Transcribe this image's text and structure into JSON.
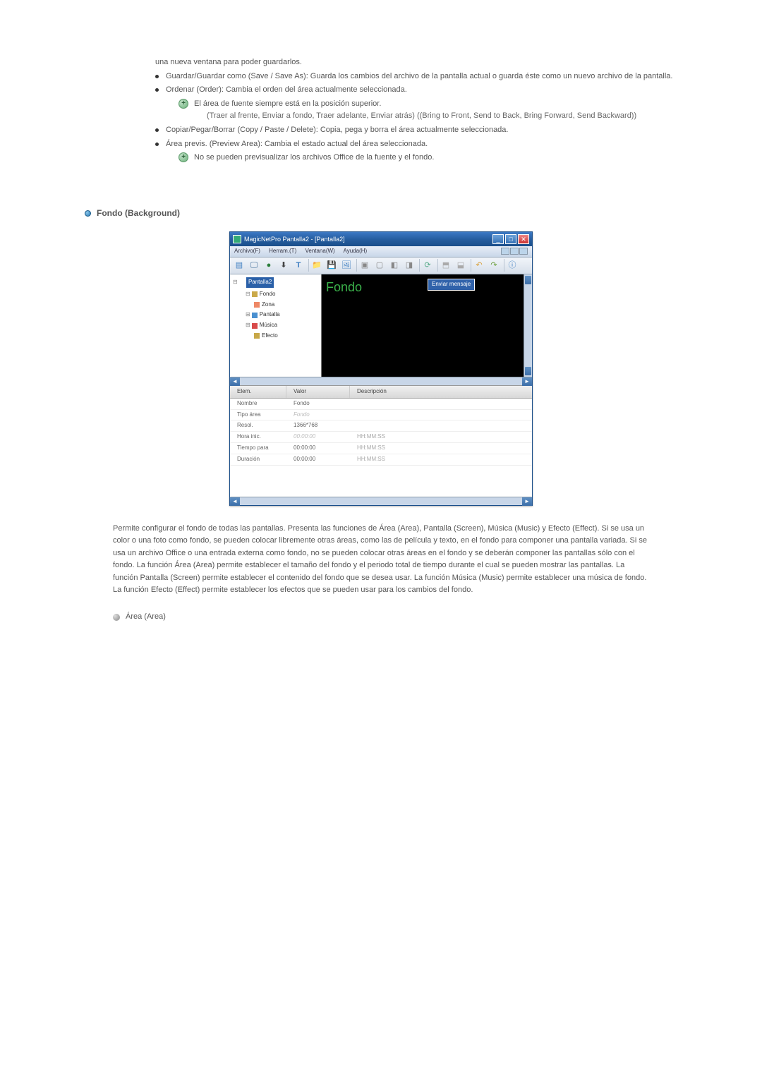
{
  "intro_line": "una nueva ventana para poder guardarlos.",
  "bullets": {
    "save": "Guardar/Guardar como (Save / Save As): Guarda los cambios del archivo de la pantalla actual o guarda éste como un nuevo archivo de la pantalla.",
    "order": "Ordenar (Order): Cambia el orden del área actualmente seleccionada.",
    "order_note": "El área de fuente siempre está en la posición superior.",
    "order_sub": "(Traer al frente, Enviar a fondo, Traer adelante, Enviar atrás) ((Bring to Front, Send to Back, Bring Forward, Send Backward))",
    "copy": "Copiar/Pegar/Borrar (Copy / Paste / Delete): Copia, pega y borra el área actualmente seleccionada.",
    "preview": "Área previs. (Preview Area): Cambia el estado actual del área seleccionada.",
    "preview_note": "No se pueden previsualizar los archivos Office de la fuente y el fondo."
  },
  "section_title": "Fondo (Background)",
  "window": {
    "title": "MagicNetPro Pantalla2 - [Pantalla2]",
    "menus": {
      "file": "Archivo(F)",
      "tools": "Herram.(T)",
      "window": "Ventana(W)",
      "help": "Ayuda(H)"
    },
    "tree": {
      "root": "Pantalla2",
      "items": [
        "Fondo",
        "Zona",
        "Pantalla",
        "Música",
        "Efecto"
      ]
    },
    "canvas": {
      "label": "Fondo",
      "message": "Enviar mensaje"
    },
    "grid": {
      "headers": {
        "elem": "Elem.",
        "valor": "Valor",
        "desc": "Descripción"
      },
      "rows": [
        {
          "elem": "Nombre",
          "valor": "Fondo",
          "desc": ""
        },
        {
          "elem": "Tipo área",
          "valor": "Fondo",
          "desc": "",
          "faded": true
        },
        {
          "elem": "Resol.",
          "valor": "1366*768",
          "desc": ""
        },
        {
          "elem": "Hora inic.",
          "valor": "00:00:00",
          "desc": "HH:MM:SS",
          "faded": true
        },
        {
          "elem": "Tiempo para",
          "valor": "00:00:00",
          "desc": "HH:MM:SS"
        },
        {
          "elem": "Duración",
          "valor": "00:00:00",
          "desc": "HH:MM:SS"
        }
      ]
    }
  },
  "body_text": "Permite configurar el fondo de todas las pantallas. Presenta las funciones de Área (Area), Pantalla (Screen), Música (Music) y Efecto (Effect). Si se usa un color o una foto como fondo, se pueden colocar libremente otras áreas, como las de película y texto, en el fondo para componer una pantalla variada. Si se usa un archivo Office o una entrada externa como fondo, no se pueden colocar otras áreas en el fondo y se deberán componer las pantallas sólo con el fondo. La función Área (Area) permite establecer el tamaño del fondo y el periodo total de tiempo durante el cual se pueden mostrar las pantallas. La función Pantalla (Screen) permite establecer el contenido del fondo que se desea usar. La función Música (Music) permite establecer una música de fondo. La función Efecto (Effect) permite establecer los efectos que se pueden usar para los cambios del fondo.",
  "sub_heading": "Área (Area)"
}
